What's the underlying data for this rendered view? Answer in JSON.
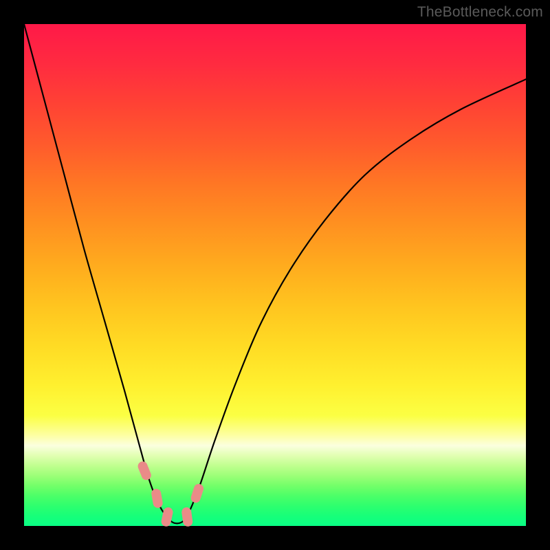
{
  "watermark": "TheBottleneck.com",
  "chart_data": {
    "type": "line",
    "title": "",
    "xlabel": "",
    "ylabel": "",
    "xlim": [
      0,
      100
    ],
    "ylim": [
      0,
      100
    ],
    "grid": false,
    "series": [
      {
        "name": "curve",
        "x": [
          0,
          4,
          8,
          12,
          16,
          20,
          23,
          25,
          27,
          29,
          30.5,
          32,
          33,
          35,
          38,
          42,
          47,
          53,
          60,
          68,
          77,
          87,
          100
        ],
        "y": [
          100,
          85,
          70,
          55,
          41,
          27,
          16,
          9,
          4,
          1.2,
          0.5,
          1.2,
          3,
          8,
          17,
          28,
          40,
          51,
          61,
          70,
          77,
          83,
          89
        ]
      }
    ],
    "markers": [
      {
        "x": 24.0,
        "y": 11.0
      },
      {
        "x": 26.5,
        "y": 5.5
      },
      {
        "x": 28.5,
        "y": 1.8
      },
      {
        "x": 32.5,
        "y": 1.8
      },
      {
        "x": 34.5,
        "y": 6.5
      }
    ],
    "background_gradient": {
      "top": "#ff1948",
      "bottom": "#0aff85"
    }
  }
}
